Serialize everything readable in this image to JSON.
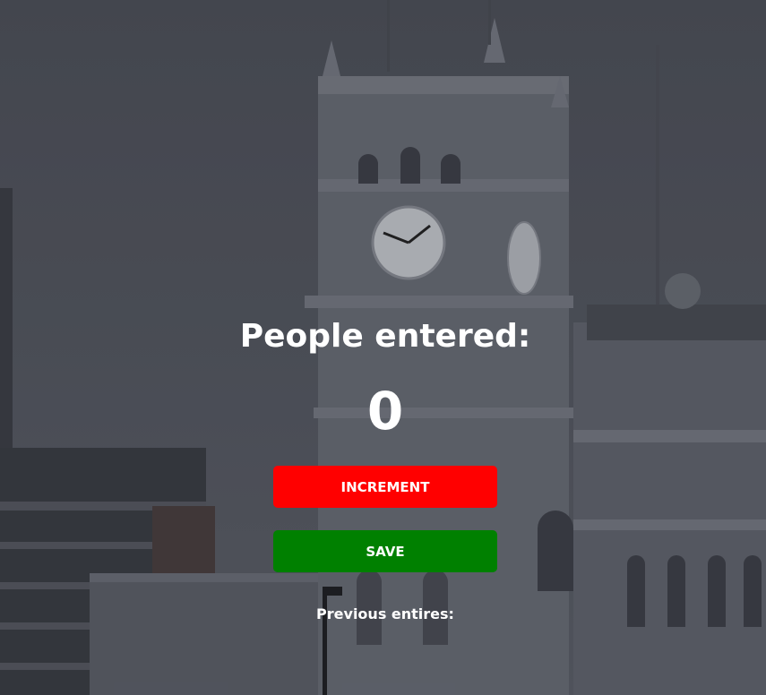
{
  "app": {
    "title": "People entered:",
    "count": "0",
    "buttons": {
      "increment_label": "INCREMENT",
      "save_label": "SAVE"
    },
    "previous_entries_label": "Previous entires:",
    "colors": {
      "increment": "#ff0000",
      "save": "#008000",
      "text": "#ffffff"
    }
  }
}
